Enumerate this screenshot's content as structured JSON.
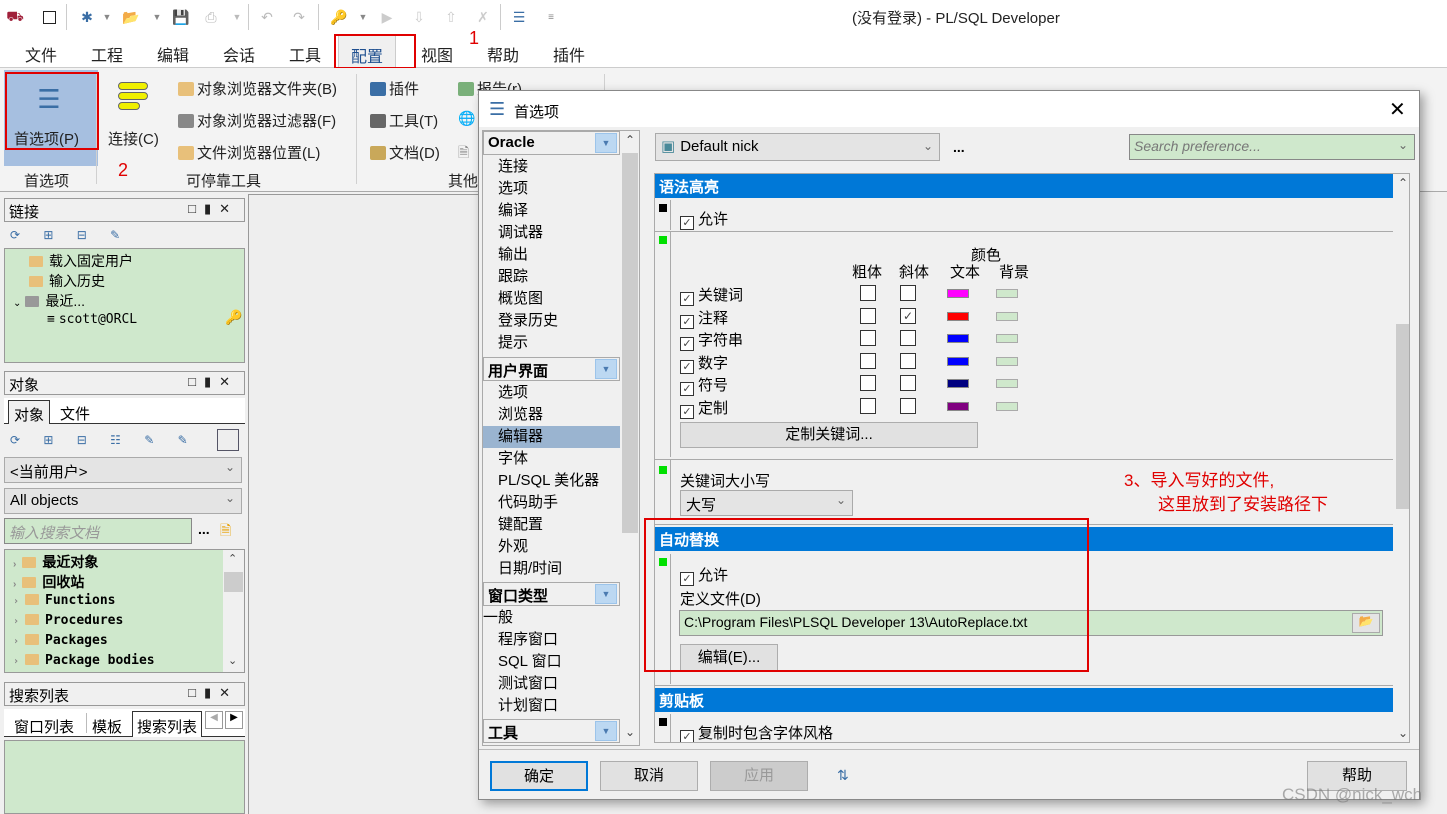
{
  "app": {
    "title": "(没有登录) - PL/SQL Developer"
  },
  "toolbar": {
    "icons": [
      "database-icon",
      "window-icon",
      "new-icon",
      "open-icon",
      "save-icon",
      "print-icon",
      "undo-icon",
      "redo-icon",
      "key-icon",
      "execute-icon",
      "commit-icon",
      "rollback-icon",
      "break-icon",
      "preferences-icon"
    ]
  },
  "menu": {
    "items": [
      "文件",
      "工程",
      "编辑",
      "会话",
      "工具",
      "配置",
      "视图",
      "帮助",
      "插件"
    ],
    "active": "配置"
  },
  "annotations": {
    "step1": "1",
    "step2": "2",
    "step3_line1": "3、导入写好的文件,",
    "step3_line2": "这里放到了安装路径下",
    "color": "#e00000"
  },
  "ribbon": {
    "preferences_btn": "首选项(P)",
    "connection_btn": "连接(C)",
    "group1_label": "首选项",
    "group2_label": "可停靠工具",
    "group3_label": "其他",
    "docking": [
      "对象浏览器文件夹(B)",
      "对象浏览器过滤器(F)",
      "文件浏览器位置(L)"
    ],
    "other_col1": [
      "插件",
      "工具(T)",
      "文档(D)"
    ],
    "other_col2_partial": "报告(r)"
  },
  "connections_panel": {
    "title": "链接",
    "tree": [
      {
        "label": "载入固定用户",
        "type": "folder"
      },
      {
        "label": "输入历史",
        "type": "folder"
      },
      {
        "label": "最近...",
        "type": "folder-expanded"
      },
      {
        "label": "scott@ORCL",
        "type": "connection"
      }
    ]
  },
  "objects_panel": {
    "title": "对象",
    "tabs": [
      "对象",
      "文件"
    ],
    "user_select": "<当前用户>",
    "filter_select": "All objects",
    "search_placeholder": "输入搜索文档",
    "more_label": "...",
    "tree": [
      "最近对象",
      "回收站",
      "Functions",
      "Procedures",
      "Packages",
      "Package bodies"
    ]
  },
  "search_panel": {
    "title": "搜索列表",
    "tabs": [
      "窗口列表",
      "模板",
      "搜索列表"
    ]
  },
  "dialog": {
    "title": "首选项",
    "profile_select": "Default nick",
    "profile_more": "...",
    "search_placeholder": "Search preference...",
    "nav": {
      "groups": [
        {
          "label": "Oracle",
          "items": [
            "连接",
            "选项",
            "编译",
            "调试器",
            "输出",
            "跟踪",
            "概览图",
            "登录历史",
            "提示"
          ]
        },
        {
          "label": "用户界面",
          "items": [
            "选项",
            "浏览器",
            "编辑器",
            "字体",
            "PL/SQL 美化器",
            "代码助手",
            "键配置",
            "外观",
            "日期/时间"
          ]
        },
        {
          "label": "窗口类型",
          "items": [
            "一般",
            "程序窗口",
            "SQL 窗口",
            "测试窗口",
            "计划窗口"
          ]
        },
        {
          "label": "工具",
          "items": []
        }
      ],
      "selected": "编辑器"
    },
    "syntax": {
      "header": "语法高亮",
      "enable_label": "允许",
      "enabled": true,
      "col_bold": "粗体",
      "col_italic": "斜体",
      "col_color": "颜色",
      "col_text": "文本",
      "col_bg": "背景",
      "rows": [
        {
          "label": "关键词",
          "enabled": true,
          "bold": false,
          "italic": false,
          "text_color": "#ff00ff",
          "bg_color": "#cfe8cc"
        },
        {
          "label": "注释",
          "enabled": true,
          "bold": false,
          "italic": true,
          "text_color": "#ff0000",
          "bg_color": "#cfe8cc"
        },
        {
          "label": "字符串",
          "enabled": true,
          "bold": false,
          "italic": false,
          "text_color": "#0000ff",
          "bg_color": "#cfe8cc"
        },
        {
          "label": "数字",
          "enabled": true,
          "bold": false,
          "italic": false,
          "text_color": "#0000ff",
          "bg_color": "#cfe8cc"
        },
        {
          "label": "符号",
          "enabled": true,
          "bold": false,
          "italic": false,
          "text_color": "#000080",
          "bg_color": "#cfe8cc"
        },
        {
          "label": "定制",
          "enabled": true,
          "bold": false,
          "italic": false,
          "text_color": "#800080",
          "bg_color": "#cfe8cc"
        }
      ],
      "custom_keywords_btn": "定制关键词..."
    },
    "keyword_case": {
      "label": "关键词大小写",
      "value": "大写"
    },
    "autoreplace": {
      "header": "自动替换",
      "enable_label": "允许",
      "enabled": true,
      "file_label": "定义文件(D)",
      "file_value": "C:\\Program Files\\PLSQL Developer 13\\AutoReplace.txt",
      "edit_btn": "编辑(E)..."
    },
    "clipboard": {
      "header": "剪贴板",
      "copy_style_label": "复制时包含字体风格",
      "copy_style_enabled": true
    },
    "buttons": {
      "ok": "确定",
      "cancel": "取消",
      "apply": "应用",
      "help": "帮助"
    },
    "header_color": "#0078d7"
  },
  "watermark": "CSDN @nick_wch"
}
